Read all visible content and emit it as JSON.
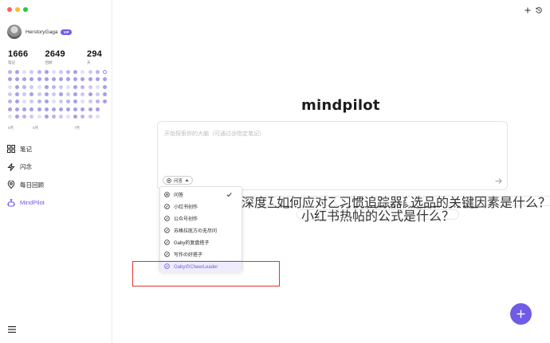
{
  "window": {
    "traffic_colors": [
      "#ff5f57",
      "#febc2e",
      "#28c840"
    ]
  },
  "profile": {
    "username": "HerstoryGaga",
    "badge": "VIP"
  },
  "stats": [
    {
      "value": "1666",
      "label": "笔记"
    },
    {
      "value": "2649",
      "label": "回顾"
    },
    {
      "value": "294",
      "label": "天"
    }
  ],
  "heatmap_months": [
    "5月",
    "6月",
    "7月"
  ],
  "nav": [
    {
      "label": "笔记",
      "icon": "notes-icon"
    },
    {
      "label": "闪念",
      "icon": "flash-icon"
    },
    {
      "label": "每日回顾",
      "icon": "pin-icon"
    },
    {
      "label": "MindPilot",
      "icon": "robot-icon"
    }
  ],
  "main": {
    "logo": "mindpilot",
    "placeholder": "开始探索你的大脑（可通过@指定笔记）",
    "mode_label": "问答"
  },
  "suggestions": [
    "深度互惠？",
    "如何应对乙方的挑战？",
    "习惯追踪器颜色如何决定？",
    "选品的关键因素是什么？",
    "小红书热帖的公式是什么？"
  ],
  "dropdown": [
    {
      "label": "问答",
      "selected": true
    },
    {
      "label": "小红书创作"
    },
    {
      "label": "公众号创作"
    },
    {
      "label": "苏格拉底方の无尽问"
    },
    {
      "label": "Gaby的复盘搭子"
    },
    {
      "label": "写作の好搭子"
    },
    {
      "label": "GabyのCheerLeader",
      "highlighted": true
    }
  ],
  "colors": {
    "accent": "#6e5ce6",
    "annotation": "#e0352b"
  }
}
